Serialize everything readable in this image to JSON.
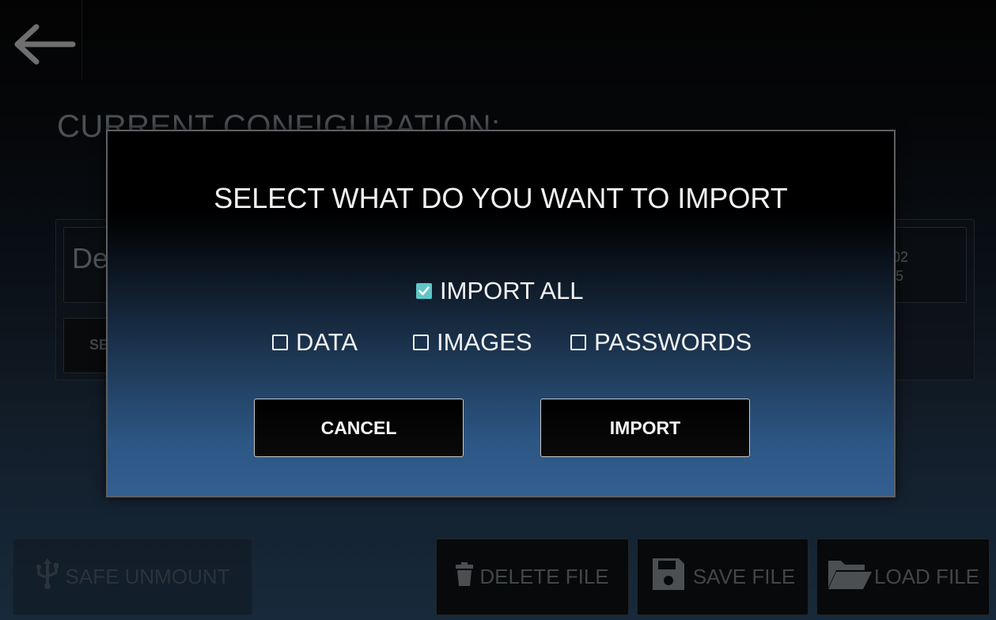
{
  "background": {
    "title": "CURRENT CONFIGURATION:",
    "field_text": "De",
    "date_text": "-02\n55",
    "select_button_label": "SE"
  },
  "dialog": {
    "title": "SELECT WHAT DO YOU WANT TO IMPORT",
    "options": {
      "all": {
        "label": "IMPORT ALL",
        "checked": true
      },
      "data": {
        "label": "DATA",
        "checked": false
      },
      "images": {
        "label": "IMAGES",
        "checked": false
      },
      "passwords": {
        "label": "PASSWORDS",
        "checked": false
      }
    },
    "cancel_label": "CANCEL",
    "import_label": "IMPORT"
  },
  "bottom_bar": {
    "safe_unmount_label": "SAFE UNMOUNT",
    "delete_file_label": "DELETE FILE",
    "save_file_label": "SAVE FILE",
    "load_file_label": "LOAD FILE"
  },
  "colors": {
    "checkbox_accent": "#5fc6c6",
    "dialog_bottom_blue": "#335f91"
  },
  "icons": {
    "back": "back-arrow-icon",
    "usb": "usb-icon",
    "trash": "trash-icon",
    "save": "floppy-disk-icon",
    "folder": "folder-open-icon",
    "checkbox_checked": "checkbox-checked-icon",
    "checkbox_empty": "checkbox-empty-icon"
  }
}
